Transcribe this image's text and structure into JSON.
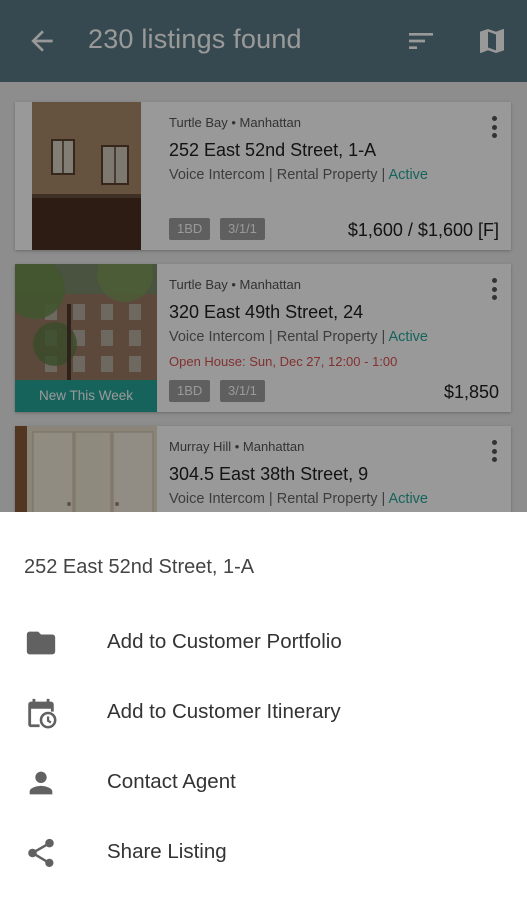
{
  "app_bar": {
    "title": "230 listings found",
    "back_icon": "arrow-left-icon",
    "sort_icon": "sort-icon",
    "map_icon": "map-icon"
  },
  "listings": [
    {
      "neighborhood": "Turtle Bay • Manhattan",
      "address": "252 East 52nd Street, 1-A",
      "meta": "Voice Intercom | Rental Property | ",
      "status": "Active",
      "chips": [
        "1BD",
        "3/1/1"
      ],
      "price": "$1,600 / $1,600 [F]"
    },
    {
      "neighborhood": "Turtle Bay • Manhattan",
      "address": "320 East 49th Street, 24",
      "meta": "Voice Intercom | Rental Property | ",
      "status": "Active",
      "open_house": "Open House: Sun, Dec 27, 12:00 - 1:00",
      "chips": [
        "1BD",
        "3/1/1"
      ],
      "price": "$1,850",
      "badge": "New This Week"
    },
    {
      "neighborhood": "Murray Hill • Manhattan",
      "address": "304.5 East 38th Street, 9",
      "meta": "Voice Intercom | Rental Property | ",
      "status": "Active"
    }
  ],
  "sheet": {
    "title": "252 East 52nd Street, 1-A",
    "items": [
      {
        "label": "Add to Customer Portfolio",
        "icon": "folder-icon"
      },
      {
        "label": "Add to Customer Itinerary",
        "icon": "calendar-clock-icon"
      },
      {
        "label": "Contact Agent",
        "icon": "person-icon"
      },
      {
        "label": "Share Listing",
        "icon": "share-icon"
      }
    ]
  },
  "colors": {
    "app_bar": "#5c7b86",
    "accent": "#26a69a",
    "open_house": "#d9534f"
  }
}
